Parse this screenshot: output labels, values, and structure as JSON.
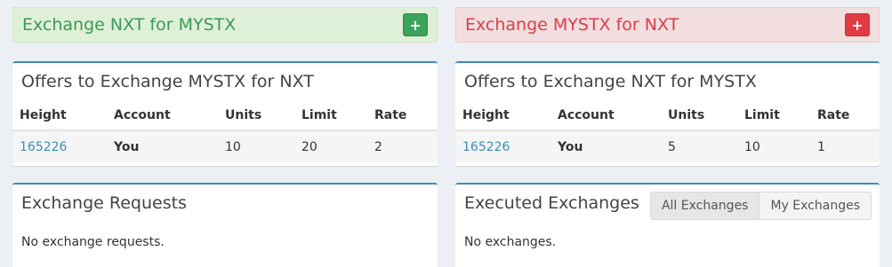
{
  "left": {
    "header": {
      "title": "Exchange NXT for MYSTX",
      "button_icon": "+"
    },
    "offers": {
      "title": "Offers to Exchange MYSTX for NXT",
      "columns": [
        "Height",
        "Account",
        "Units",
        "Limit",
        "Rate"
      ],
      "rows": [
        {
          "height": "165226",
          "account": "You",
          "units": "10",
          "limit": "20",
          "rate": "2"
        }
      ]
    },
    "requests": {
      "title": "Exchange Requests",
      "empty_text": "No exchange requests."
    }
  },
  "right": {
    "header": {
      "title": "Exchange MYSTX for NXT",
      "button_icon": "+"
    },
    "offers": {
      "title": "Offers to Exchange NXT for MYSTX",
      "columns": [
        "Height",
        "Account",
        "Units",
        "Limit",
        "Rate"
      ],
      "rows": [
        {
          "height": "165226",
          "account": "You",
          "units": "5",
          "limit": "10",
          "rate": "1"
        }
      ]
    },
    "executed": {
      "title": "Executed Exchanges",
      "tabs": [
        "All Exchanges",
        "My Exchanges"
      ],
      "empty_text": "No exchanges."
    }
  },
  "colors": {
    "buy_header": "#dff0d8",
    "sell_header": "#f2dede",
    "accent": "#3c8dbc"
  }
}
